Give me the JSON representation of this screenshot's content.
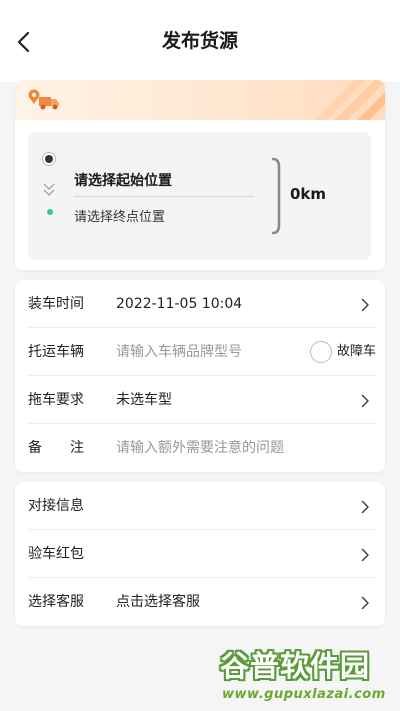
{
  "header": {
    "title": "发布货源"
  },
  "route": {
    "start_placeholder": "请选择起始位置",
    "end_placeholder": "请选择终点位置",
    "distance": "0km"
  },
  "form": {
    "load_time": {
      "label": "装车时间",
      "value": "2022-11-05 10:04"
    },
    "vehicle": {
      "label": "托运车辆",
      "placeholder": "请输入车辆品牌型号",
      "fault_label": "故障车"
    },
    "tow": {
      "label": "拖车要求",
      "value": "未选车型"
    },
    "remark": {
      "label": "备　　注",
      "placeholder": "请输入额外需要注意的问题"
    }
  },
  "form2": {
    "contact": {
      "label": "对接信息"
    },
    "redpacket": {
      "label": "验车红包"
    },
    "service": {
      "label": "选择客服",
      "value": "点击选择客服"
    }
  },
  "watermark": {
    "main": "谷普软件园",
    "url": "www.gupuxlazai.com"
  },
  "colors": {
    "accent_orange": "#f2883a",
    "end_dot": "#2ecc8a",
    "watermark_green": "#5a9a3a"
  }
}
